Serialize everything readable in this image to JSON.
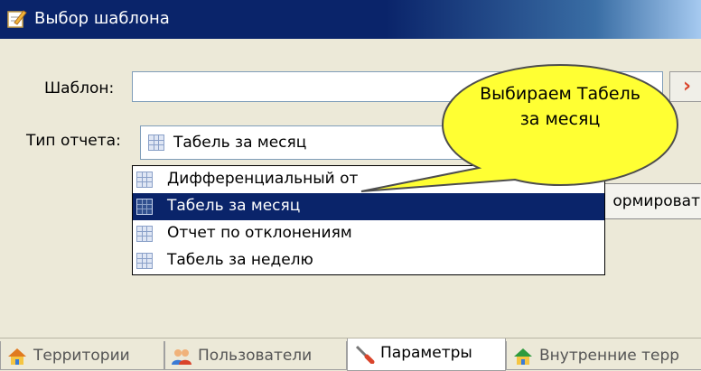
{
  "window": {
    "title": "Выбор шаблона"
  },
  "form": {
    "template_label": "Шаблон:",
    "template_value": "",
    "report_type_label": "Тип отчета:",
    "report_type_value": "Табель за месяц",
    "side_button_icon": "red-arrow-icon",
    "generate_button_label": "ормироват"
  },
  "dropdown": {
    "items": [
      {
        "label": "Дифференциальный от",
        "icon": "grid-icon",
        "selected": false
      },
      {
        "label": "Табель за месяц",
        "icon": "grid-icon",
        "selected": true
      },
      {
        "label": "Отчет по отклонениям",
        "icon": "grid-icon",
        "selected": false
      },
      {
        "label": "Табель за неделю",
        "icon": "grid-icon",
        "selected": false
      }
    ]
  },
  "callout": {
    "text": "Выбираем Табель за месяц",
    "color": "#ffff33"
  },
  "tabs": [
    {
      "label": "Территории",
      "icon": "house-icon",
      "active": false
    },
    {
      "label": "Пользователи",
      "icon": "users-icon",
      "active": false
    },
    {
      "label": "Параметры",
      "icon": "wrench-icon",
      "active": true
    },
    {
      "label": "Внутренние терр",
      "icon": "house-icon",
      "active": false
    }
  ],
  "colors": {
    "titlebar": "#0a246a",
    "selection": "#0a246a",
    "dialog": "#ece9d8"
  }
}
